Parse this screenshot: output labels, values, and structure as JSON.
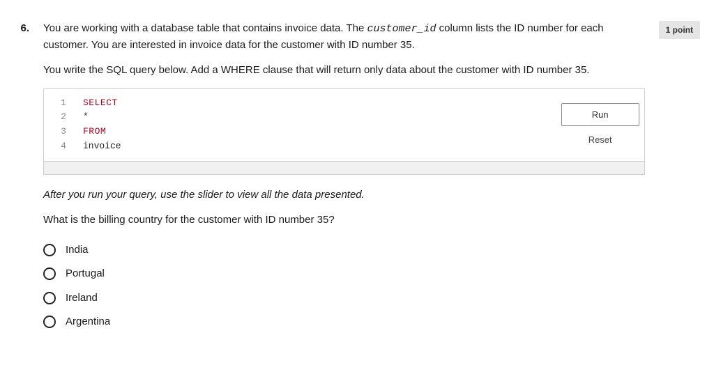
{
  "question": {
    "number": "6.",
    "points_label": "1 point",
    "paragraph1_a": "You are working with a database table that contains invoice data. The ",
    "paragraph1_code": "customer_id",
    "paragraph1_b": " column lists the ID number for each customer. You are interested in invoice data for the customer with ID number 35.",
    "paragraph2": "You write the SQL query below. Add a WHERE clause that will return only data about the customer with ID number 35.",
    "after_run": "After you run your query, use the slider to view all the data presented.",
    "followup": "What is the billing country for the customer with ID number 35?"
  },
  "code": {
    "lines": [
      {
        "n": "1",
        "kw": "SELECT",
        "id": ""
      },
      {
        "n": "2",
        "kw": "",
        "id": "*"
      },
      {
        "n": "3",
        "kw": "FROM",
        "id": ""
      },
      {
        "n": "4",
        "kw": "",
        "id": "invoice"
      }
    ],
    "run_label": "Run",
    "reset_label": "Reset"
  },
  "options": [
    "India",
    "Portugal",
    "Ireland",
    "Argentina"
  ]
}
